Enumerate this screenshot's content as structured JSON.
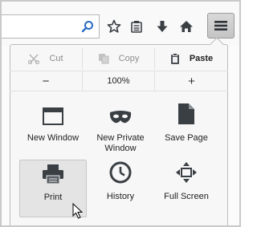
{
  "toolbar": {
    "icons": [
      "search-icon",
      "star-icon",
      "reading-list-icon",
      "download-icon",
      "home-icon",
      "hamburger-menu-icon"
    ]
  },
  "menu": {
    "edit": {
      "cut": "Cut",
      "copy": "Copy",
      "paste": "Paste"
    },
    "zoom": {
      "minus": "−",
      "level": "100%",
      "plus": "+"
    },
    "grid": [
      {
        "label": "New Window",
        "icon": "new-window-icon"
      },
      {
        "label": "New Private\nWindow",
        "icon": "private-mask-icon"
      },
      {
        "label": "Save Page",
        "icon": "save-page-icon"
      },
      {
        "label": "Print",
        "icon": "printer-icon"
      },
      {
        "label": "History",
        "icon": "history-clock-icon"
      },
      {
        "label": "Full Screen",
        "icon": "fullscreen-icon"
      }
    ]
  },
  "colors": {
    "icon": "#3a3f44",
    "icon_light": "#5a6066",
    "panel": "#f7f7f7",
    "hover": "#e4e4e4"
  }
}
